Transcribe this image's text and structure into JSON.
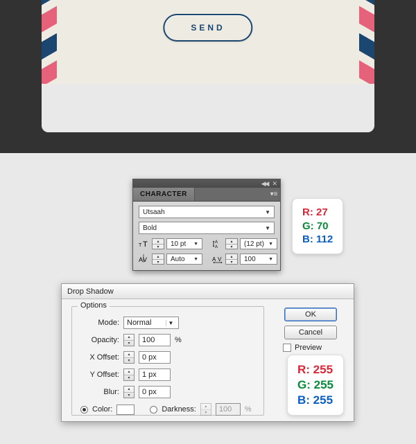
{
  "envelope": {
    "send_label": "SEND"
  },
  "character_panel": {
    "tab": "CHARACTER",
    "font": "Utsaah",
    "style": "Bold",
    "size": "10 pt",
    "leading": "(12 pt)",
    "kerning": "Auto",
    "tracking": "100"
  },
  "color_hint_1": {
    "r": "R: 27",
    "g": "G: 70",
    "b": "B: 112"
  },
  "drop_shadow": {
    "title": "Drop Shadow",
    "options_label": "Options",
    "mode_label": "Mode:",
    "mode": "Normal",
    "opacity_label": "Opacity:",
    "opacity": "100",
    "opacity_unit": "%",
    "xoffset_label": "X Offset:",
    "xoffset": "0 px",
    "yoffset_label": "Y Offset:",
    "yoffset": "1 px",
    "blur_label": "Blur:",
    "blur": "0 px",
    "color_label": "Color:",
    "darkness_label": "Darkness:",
    "darkness": "100",
    "darkness_unit": "%",
    "ok": "OK",
    "cancel": "Cancel",
    "preview": "Preview"
  },
  "color_hint_2": {
    "r": "R: 255",
    "g": "G: 255",
    "b": "B: 255"
  }
}
